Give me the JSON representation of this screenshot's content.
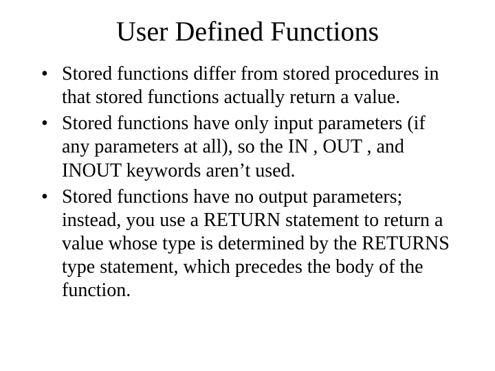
{
  "title": "User Defined Functions",
  "bullets": [
    "Stored functions differ from stored procedures in that stored functions actually return a value.",
    "Stored functions have only input parameters (if any parameters at all), so the IN , OUT , and INOUT keywords aren’t used.",
    "Stored functions have no output parameters; instead, you use a RETURN statement to return a value whose type is determined by the RETURNS type statement, which precedes the body of the function."
  ]
}
